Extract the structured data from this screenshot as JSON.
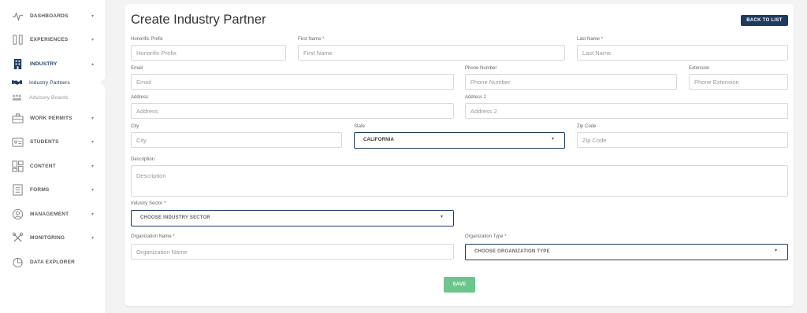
{
  "sidebar": {
    "items": [
      {
        "key": "dashboards",
        "label": "DASHBOARDS",
        "icon": "pulse-icon",
        "chevron": "▾"
      },
      {
        "key": "experiences",
        "label": "EXPERIENCES",
        "icon": "columns-icon",
        "chevron": "▾"
      },
      {
        "key": "industry",
        "label": "INDUSTRY",
        "icon": "building-icon",
        "chevron": "▴"
      },
      {
        "key": "work_permits",
        "label": "WORK PERMITS",
        "icon": "briefcase-icon",
        "chevron": "▾"
      },
      {
        "key": "students",
        "label": "STUDENTS",
        "icon": "id-card-icon",
        "chevron": "▾"
      },
      {
        "key": "content",
        "label": "CONTENT",
        "icon": "layout-icon",
        "chevron": "▾"
      },
      {
        "key": "forms",
        "label": "FORMS",
        "icon": "form-icon",
        "chevron": "▾"
      },
      {
        "key": "management",
        "label": "MANAGEMENT",
        "icon": "user-circle-icon",
        "chevron": "▾"
      },
      {
        "key": "monitoring",
        "label": "MONITORING",
        "icon": "tools-icon",
        "chevron": "▾"
      },
      {
        "key": "data_explorer",
        "label": "DATA EXPLORER",
        "icon": "pie-chart-icon",
        "chevron": ""
      }
    ],
    "subitems": [
      {
        "label": "Industry Partners",
        "icon": "handshake-icon"
      },
      {
        "label": "Advisory Boards",
        "icon": "group-icon"
      }
    ]
  },
  "page": {
    "title": "Create Industry Partner",
    "back_label": "BACK TO LIST"
  },
  "form": {
    "honorific_prefix": {
      "label": "Honorific Prefix",
      "placeholder": "Honorific Prefix"
    },
    "first_name": {
      "label": "First Name *",
      "placeholder": "First Name"
    },
    "last_name": {
      "label": "Last Name *",
      "placeholder": "Last Name"
    },
    "email": {
      "label": "Email",
      "placeholder": "Email"
    },
    "phone": {
      "label": "Phone Number",
      "placeholder": "Phone Number"
    },
    "extension": {
      "label": "Extension",
      "placeholder": "Phone Extension"
    },
    "address": {
      "label": "Address",
      "placeholder": "Address"
    },
    "address2": {
      "label": "Address 2",
      "placeholder": "Address 2"
    },
    "city": {
      "label": "City",
      "placeholder": "City"
    },
    "state": {
      "label": "State",
      "value": "CALIFORNIA"
    },
    "zip": {
      "label": "Zip Code",
      "placeholder": "Zip Code"
    },
    "description": {
      "label": "Description",
      "placeholder": "Description"
    },
    "industry_sector": {
      "label": "Industry Sector *",
      "value": "CHOOSE INDUSTRY SECTOR"
    },
    "org_name": {
      "label": "Organization Name *",
      "placeholder": "Organization Name"
    },
    "org_type": {
      "label": "Organization Type *",
      "value": "CHOOSE ORGANIZATION TYPE"
    },
    "save_label": "SAVE"
  },
  "colors": {
    "brand": "#1e3a5f",
    "save": "#6cc58c",
    "background": "#f3f3f3"
  }
}
